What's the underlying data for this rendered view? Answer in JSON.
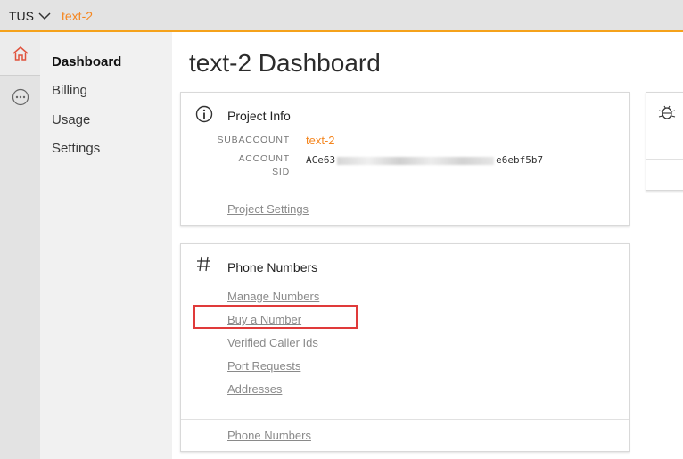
{
  "topbar": {
    "account": "TUS",
    "project": "text-2"
  },
  "rail": {
    "home_icon": "home-icon",
    "more_icon": "more-icon"
  },
  "subnav": {
    "items": [
      {
        "label": "Dashboard",
        "active": true
      },
      {
        "label": "Billing"
      },
      {
        "label": "Usage"
      },
      {
        "label": "Settings"
      }
    ]
  },
  "page": {
    "title": "text-2 Dashboard"
  },
  "project_info": {
    "title": "Project Info",
    "icon": "info-icon",
    "subaccount_label": "SUBACCOUNT",
    "subaccount_value": "text-2",
    "account_sid_label_1": "ACCOUNT",
    "account_sid_label_2": "SID",
    "account_sid_prefix": "ACe63",
    "account_sid_suffix": "e6ebf5b7",
    "footer_link": "Project Settings"
  },
  "phone_numbers": {
    "title": "Phone Numbers",
    "icon": "hash-icon",
    "links": [
      "Manage Numbers",
      "Buy a Number",
      "Verified Caller Ids",
      "Port Requests",
      "Addresses"
    ],
    "footer_link": "Phone Numbers"
  },
  "side_card": {
    "icon": "bug-icon"
  },
  "colors": {
    "accent": "#f5861f",
    "highlight": "#e03a3a"
  }
}
